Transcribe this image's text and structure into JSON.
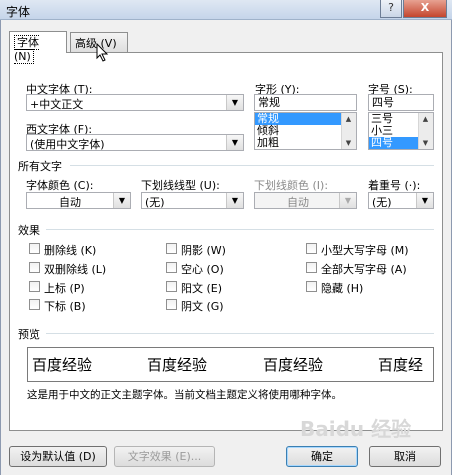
{
  "window": {
    "title": "字体",
    "help": "?",
    "close": "X"
  },
  "tabs": [
    {
      "label": "字体 (N)"
    },
    {
      "label": "高级 (V)"
    }
  ],
  "font": {
    "chinese_label": "中文字体 (T):",
    "chinese_value": "+中文正文",
    "western_label": "西文字体 (F):",
    "western_value": "(使用中文字体)",
    "style_label": "字形 (Y):",
    "style_value": "常规",
    "style_options": [
      "常规",
      "倾斜",
      "加粗"
    ],
    "size_label": "字号 (S):",
    "size_value": "四号",
    "size_options": [
      "三号",
      "小三",
      "四号"
    ]
  },
  "all_text": {
    "heading": "所有文字",
    "color_label": "字体颜色 (C):",
    "color_value": "自动",
    "underline_label": "下划线线型 (U):",
    "underline_value": "(无)",
    "underline_color_label": "下划线颜色 (I):",
    "underline_color_value": "自动",
    "emphasis_label": "着重号 (·):",
    "emphasis_value": "(无)"
  },
  "effects": {
    "heading": "效果",
    "items": [
      "删除线 (K)",
      "阴影 (W)",
      "小型大写字母 (M)",
      "双删除线 (L)",
      "空心 (O)",
      "全部大写字母 (A)",
      "上标 (P)",
      "阳文 (E)",
      "隐藏 (H)",
      "下标 (B)",
      "阴文 (G)"
    ]
  },
  "preview": {
    "heading": "预览",
    "samples": [
      "百度经验",
      "百度经验",
      "百度经验",
      "百度经"
    ],
    "description": "这是用于中文的正文主题字体。当前文档主题定义将使用哪种字体。"
  },
  "buttons": {
    "set_default": "设为默认值 (D)",
    "text_effects": "文字效果 (E)...",
    "ok": "确定",
    "cancel": "取消"
  },
  "watermark": "Baidu 经验"
}
